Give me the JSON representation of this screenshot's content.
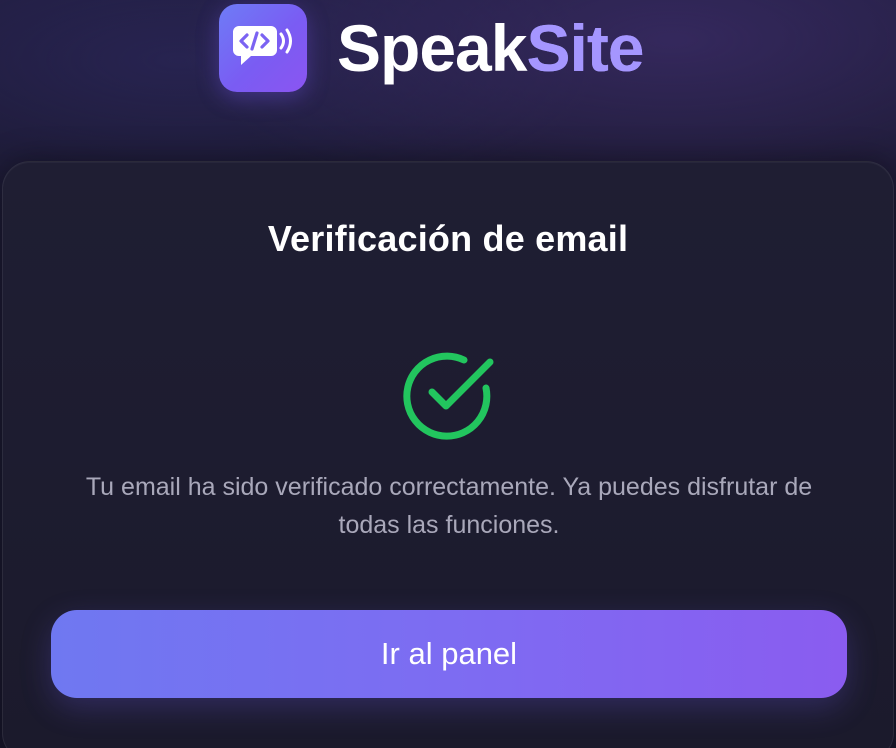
{
  "brand": {
    "name_primary": "Speak",
    "name_accent": "Site",
    "logo_icon": "code-speech-bubble-icon"
  },
  "card": {
    "title": "Verificación de email",
    "status_icon": "check-circle-icon",
    "message": "Tu email ha sido verificado correctamente. Ya puedes disfrutar de todas las funciones.",
    "button_label": "Ir al panel"
  },
  "colors": {
    "background": "#1c1a33",
    "card": "#1e1d31",
    "success": "#22c55e",
    "accent_start": "#6f78f1",
    "accent_end": "#8a5cf0",
    "text_muted": "#a9a8ba"
  }
}
